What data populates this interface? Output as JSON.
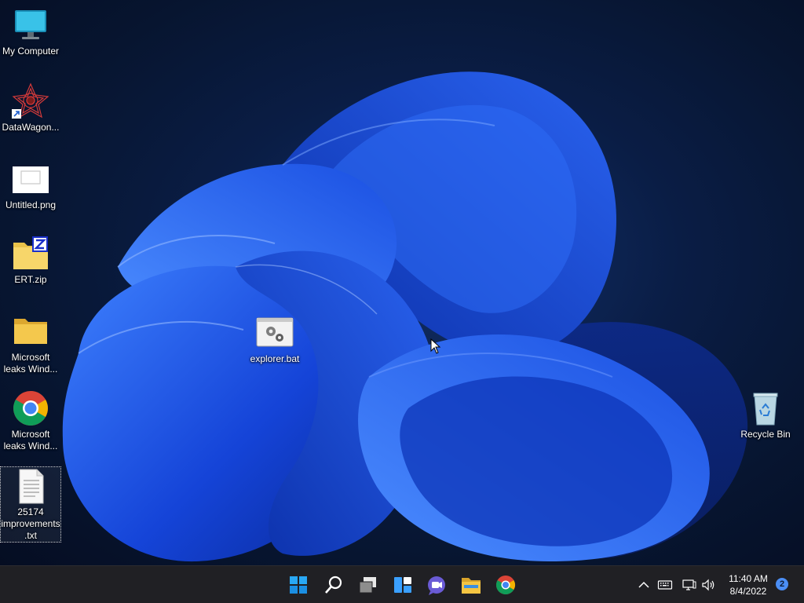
{
  "desktop": {
    "icons": [
      {
        "label": "My Computer",
        "icon": "monitor-icon"
      },
      {
        "label": "DataWagon...",
        "icon": "app-shortcut-icon"
      },
      {
        "label": "Untitled.png",
        "icon": "image-file-icon"
      },
      {
        "label": "ERT.zip",
        "icon": "zip-folder-icon"
      },
      {
        "label": "Microsoft leaks Wind...",
        "icon": "folder-icon"
      },
      {
        "label": "Microsoft leaks Wind...",
        "icon": "chrome-icon"
      },
      {
        "label": "25174 improvements.txt",
        "icon": "text-file-icon"
      },
      {
        "label": "explorer.bat",
        "icon": "batch-file-icon"
      },
      {
        "label": "Recycle Bin",
        "icon": "recycle-bin-icon"
      }
    ]
  },
  "taskbar": {
    "apps": [
      {
        "name": "Start",
        "icon": "windows-start-icon"
      },
      {
        "name": "Search",
        "icon": "search-icon"
      },
      {
        "name": "Task View",
        "icon": "task-view-icon"
      },
      {
        "name": "Widgets",
        "icon": "widgets-icon"
      },
      {
        "name": "Chat",
        "icon": "chat-icon"
      },
      {
        "name": "File Explorer",
        "icon": "file-explorer-icon"
      },
      {
        "name": "Google Chrome",
        "icon": "chrome-icon"
      }
    ],
    "tray": {
      "time": "11:40 AM",
      "date": "8/4/2022",
      "notification_count": "2"
    }
  },
  "colors": {
    "taskbar_bg": "#202024",
    "desktop_bg": "#0a1d45",
    "accent": "#4b8ef5"
  }
}
